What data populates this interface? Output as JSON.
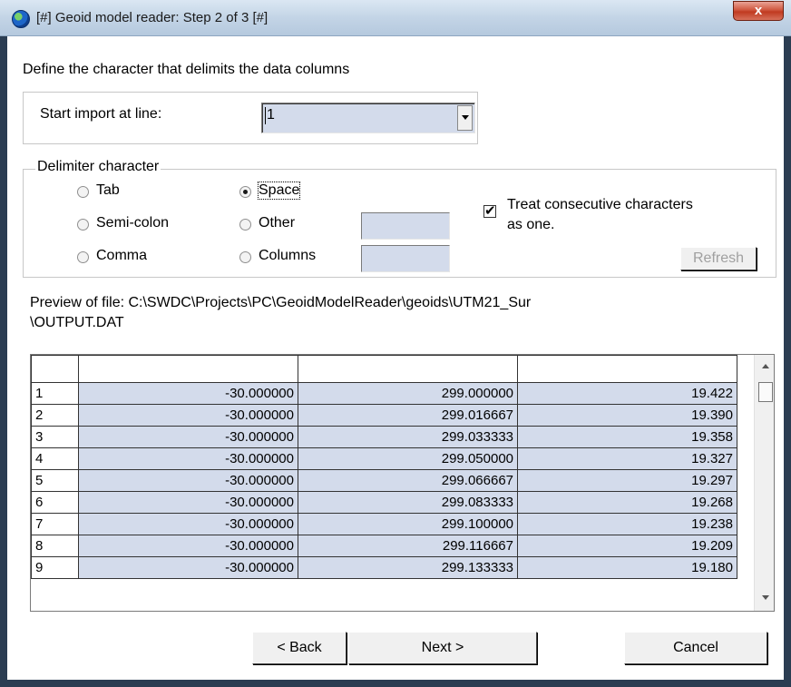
{
  "window": {
    "title": "[#] Geoid model reader: Step 2 of 3 [#]",
    "close_label": "x"
  },
  "instructions": "Define the character that delimits the data columns",
  "start_import": {
    "label": "Start import at line:",
    "value": "1"
  },
  "delimiter": {
    "group_label": "Delimiter character",
    "tab": "Tab",
    "space": "Space",
    "semicolon": "Semi-colon",
    "other": "Other",
    "comma": "Comma",
    "columns": "Columns",
    "selected": "space",
    "treat_consecutive": "Treat consecutive characters as one.",
    "treat_consecutive_line1": "Treat consecutive characters",
    "treat_consecutive_line2": "as one.",
    "treat_consecutive_checked": true,
    "refresh_label": "Refresh"
  },
  "preview": {
    "line1": "Preview of file: C:\\SWDC\\Projects\\PC\\GeoidModelReader\\geoids\\UTM21_Sur",
    "line2": "\\OUTPUT.DAT"
  },
  "grid": {
    "headers": [
      "",
      "",
      "",
      ""
    ],
    "rows": [
      [
        "1",
        "-30.000000",
        "299.000000",
        "19.422"
      ],
      [
        "2",
        "-30.000000",
        "299.016667",
        "19.390"
      ],
      [
        "3",
        "-30.000000",
        "299.033333",
        "19.358"
      ],
      [
        "4",
        "-30.000000",
        "299.050000",
        "19.327"
      ],
      [
        "5",
        "-30.000000",
        "299.066667",
        "19.297"
      ],
      [
        "6",
        "-30.000000",
        "299.083333",
        "19.268"
      ],
      [
        "7",
        "-30.000000",
        "299.100000",
        "19.238"
      ],
      [
        "8",
        "-30.000000",
        "299.116667",
        "19.209"
      ],
      [
        "9",
        "-30.000000",
        "299.133333",
        "19.180"
      ]
    ]
  },
  "buttons": {
    "back": "< Back",
    "next": "Next >",
    "cancel": "Cancel"
  }
}
